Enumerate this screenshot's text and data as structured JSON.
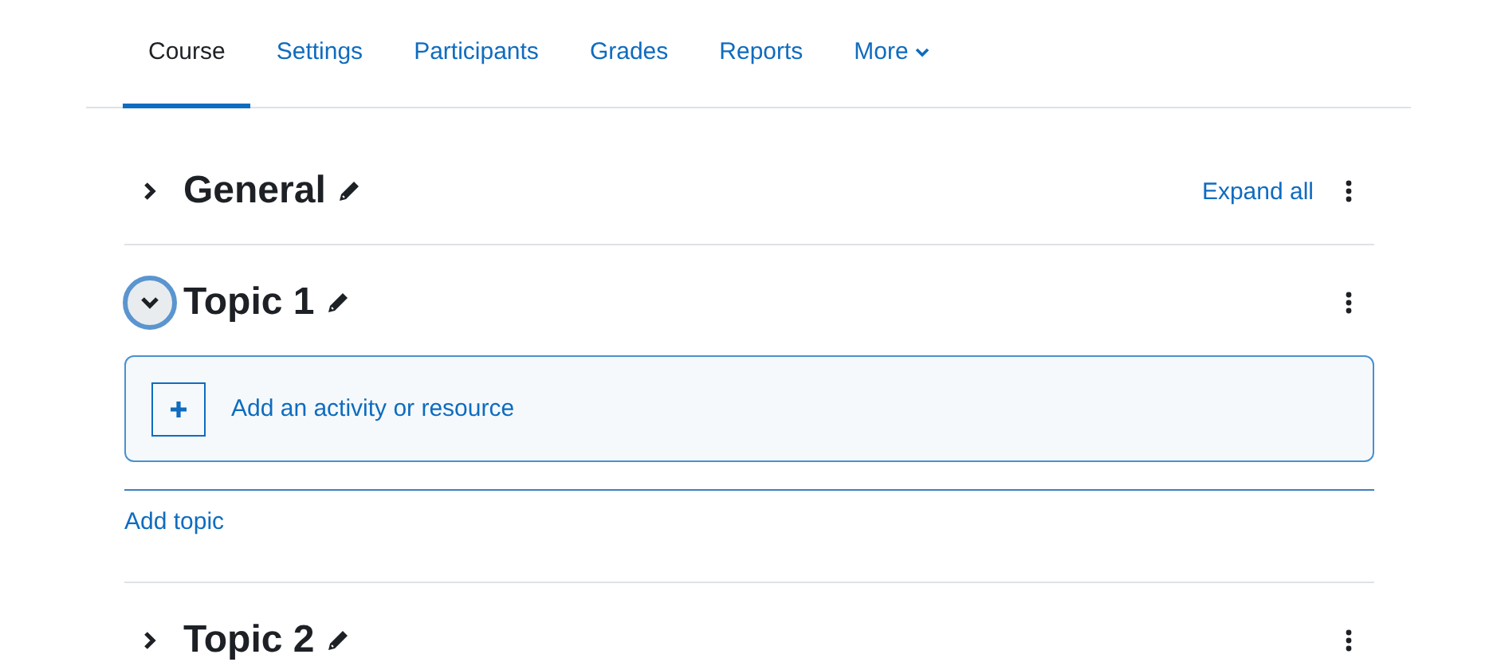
{
  "tabs": [
    {
      "label": "Course",
      "selected": true,
      "kind": "link"
    },
    {
      "label": "Settings",
      "selected": false,
      "kind": "link"
    },
    {
      "label": "Participants",
      "selected": false,
      "kind": "link"
    },
    {
      "label": "Grades",
      "selected": false,
      "kind": "link"
    },
    {
      "label": "Reports",
      "selected": false,
      "kind": "link"
    },
    {
      "label": "More",
      "selected": false,
      "kind": "menu"
    }
  ],
  "sections": [
    {
      "title": "General",
      "expanded": false,
      "focused": false,
      "action": "Expand all"
    },
    {
      "title": "Topic 1",
      "expanded": true,
      "focused": true,
      "add_activity": "Add an activity or resource",
      "add_topic": "Add topic"
    },
    {
      "title": "Topic 2",
      "expanded": false,
      "focused": false
    }
  ]
}
